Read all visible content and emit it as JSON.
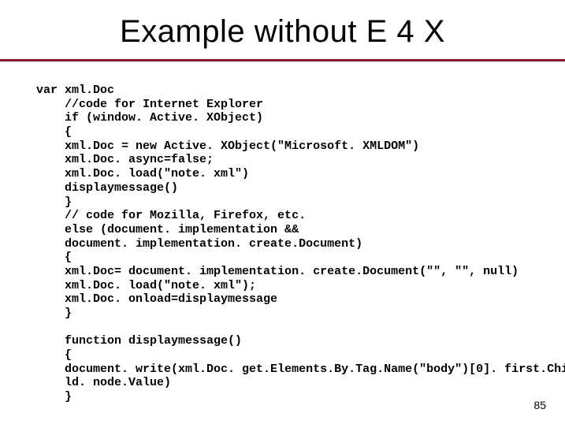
{
  "title": "Example without E 4 X",
  "code": {
    "var_kw": "var ",
    "l1": "xml.Doc",
    "l2": "//code for Internet Explorer",
    "l3": "if (window. Active. XObject)",
    "l4": "{",
    "l5": "xml.Doc = new Active. XObject(\"Microsoft. XMLDOM\")",
    "l6": "xml.Doc. async=false;",
    "l7": "xml.Doc. load(\"note. xml\")",
    "l8": "displaymessage()",
    "l9": "}",
    "l10": "// code for Mozilla, Firefox, etc.",
    "l11": "else (document. implementation &&",
    "l12": "document. implementation. create.Document)",
    "l13": "{",
    "l14": "xml.Doc= document. implementation. create.Document(\"\", \"\", null)",
    "l15": "xml.Doc. load(\"note. xml\");",
    "l16": "xml.Doc. onload=displaymessage",
    "l17": "}",
    "f1": "function displaymessage()",
    "f2": "{",
    "f3": "document. write(xml.Doc. get.Elements.By.Tag.Name(\"body\")[0]. first.Chi",
    "f4": "ld. node.Value)",
    "f5": "}"
  },
  "page_number": "85"
}
